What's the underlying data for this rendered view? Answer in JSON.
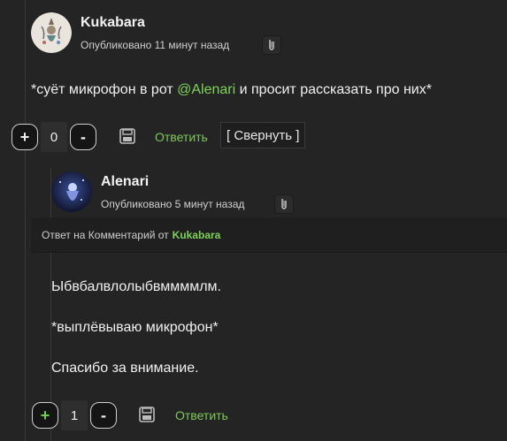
{
  "comment": {
    "author": "Kukabara",
    "published": "Опубликовано 11 минут назад",
    "text_before": "*суёт микрофон в рот ",
    "mention": "@Alenari",
    "text_after": " и просит рассказать про них*",
    "vote_plus": "+",
    "vote_count": "0",
    "vote_minus": "-",
    "reply_label": "Ответить",
    "collapse_label": "[ Свернуть ]"
  },
  "reply": {
    "author": "Alenari",
    "published": "Опубликовано 5 минут назад",
    "reply_to_prefix": "Ответ на Комментарий от",
    "reply_to_author": "Kukabara",
    "paragraphs": [
      "Ыбвбалвлолыбвммммлм.",
      "*выплёвываю микрофон*",
      "Спасибо за внимание."
    ],
    "vote_plus": "+",
    "vote_count": "1",
    "vote_minus": "-",
    "reply_label": "Ответить"
  },
  "colors": {
    "background": "#242424",
    "accent_green": "#7ed35a"
  },
  "icons": [
    "pin-icon",
    "save-icon"
  ]
}
